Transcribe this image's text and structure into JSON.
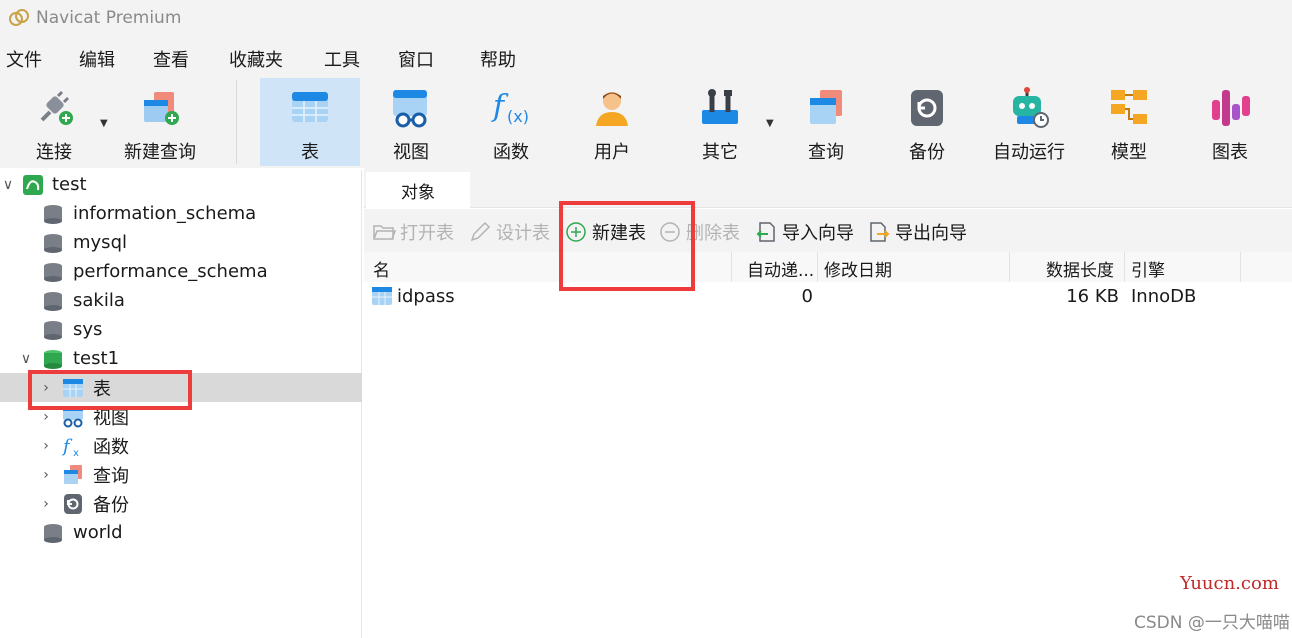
{
  "window": {
    "title": "Navicat Premium"
  },
  "menu": [
    "文件",
    "编辑",
    "查看",
    "收藏夹",
    "工具",
    "窗口",
    "帮助"
  ],
  "toolbar": {
    "connect": "连接",
    "new_query": "新建查询",
    "table": "表",
    "view": "视图",
    "function": "函数",
    "user": "用户",
    "other": "其它",
    "query": "查询",
    "backup": "备份",
    "automation": "自动运行",
    "model": "模型",
    "chart": "图表"
  },
  "sidebar": {
    "connection": "test",
    "databases": [
      "information_schema",
      "mysql",
      "performance_schema",
      "sakila",
      "sys"
    ],
    "open_db": "test1",
    "children": [
      "表",
      "视图",
      "函数",
      "查询",
      "备份"
    ],
    "last_db": "world"
  },
  "main": {
    "tab": "对象",
    "actions": {
      "open_table": "打开表",
      "design_table": "设计表",
      "new_table": "新建表",
      "delete_table": "删除表",
      "import_wizard": "导入向导",
      "export_wizard": "导出向导"
    },
    "columns": [
      "名",
      "自动递...",
      "修改日期",
      "数据长度",
      "引擎"
    ],
    "rows": [
      {
        "name": "idpass",
        "auto_inc": "0",
        "modified": "",
        "data_length": "16 KB",
        "engine": "InnoDB"
      }
    ]
  },
  "watermark": {
    "site": "Yuucn.com",
    "credit": "CSDN @一只大喵喵"
  },
  "colors": {
    "accent": "#1e88e5",
    "highlight": "#ee3b3b",
    "selected_bg": "#cfe4f7"
  }
}
